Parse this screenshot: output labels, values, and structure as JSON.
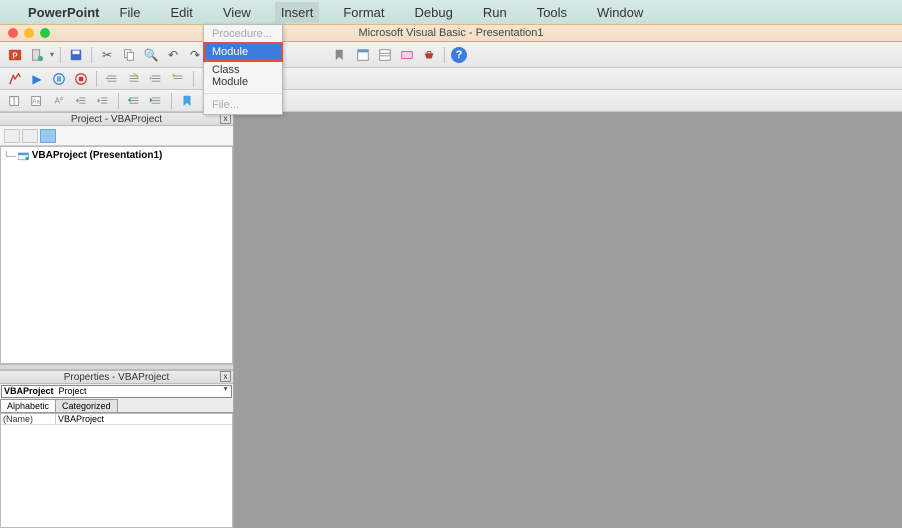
{
  "menubar": {
    "app_name": "PowerPoint",
    "items": [
      "File",
      "Edit",
      "View",
      "Insert",
      "Format",
      "Debug",
      "Run",
      "Tools",
      "Window"
    ],
    "active_index": 3
  },
  "insert_menu": {
    "procedure": "Procedure...",
    "module": "Module",
    "class_module": "Class Module",
    "file": "File...",
    "highlighted_index": 1
  },
  "window": {
    "title": "Microsoft Visual Basic - Presentation1"
  },
  "project_pane": {
    "title": "Project - VBAProject",
    "tree_item": "VBAProject (Presentation1)"
  },
  "properties_pane": {
    "title": "Properties - VBAProject",
    "object_selector": "VBAProject  Project",
    "tabs": {
      "tab1": "Alphabetic",
      "tab2": "Categorized"
    },
    "rows": [
      {
        "name": "(Name)",
        "value": "VBAProject"
      }
    ]
  }
}
